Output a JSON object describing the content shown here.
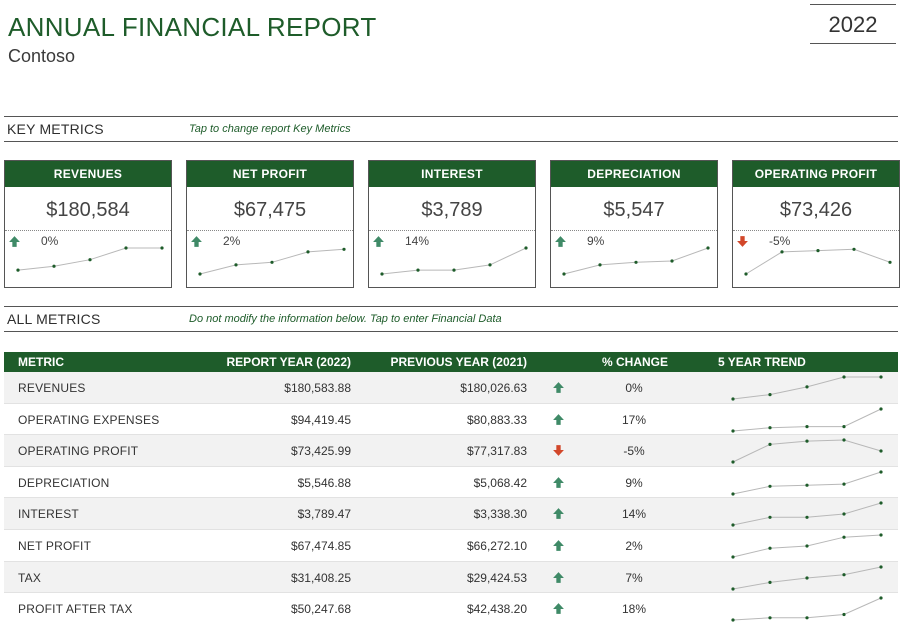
{
  "header": {
    "title": "ANNUAL FINANCIAL REPORT",
    "company": "Contoso",
    "year": "2022"
  },
  "key_metrics_section": {
    "title": "KEY METRICS",
    "note": "Tap to change report Key Metrics"
  },
  "cards": [
    {
      "label": "REVENUES",
      "value": "$180,584",
      "change": "0%",
      "direction": "up",
      "trend": [
        0.15,
        0.3,
        0.55,
        1.0,
        1.0
      ]
    },
    {
      "label": "NET PROFIT",
      "value": "$67,475",
      "change": "2%",
      "direction": "up",
      "trend": [
        0.0,
        0.35,
        0.45,
        0.85,
        0.95
      ]
    },
    {
      "label": "INTEREST",
      "value": "$3,789",
      "change": "14%",
      "direction": "up",
      "trend": [
        0.0,
        0.15,
        0.15,
        0.35,
        1.0
      ]
    },
    {
      "label": "DEPRECIATION",
      "value": "$5,547",
      "change": "9%",
      "direction": "up",
      "trend": [
        0.0,
        0.35,
        0.45,
        0.5,
        1.0
      ]
    },
    {
      "label": "OPERATING PROFIT",
      "value": "$73,426",
      "change": "-5%",
      "direction": "down",
      "trend": [
        0.0,
        0.85,
        0.9,
        0.95,
        0.45
      ]
    }
  ],
  "all_metrics_section": {
    "title": "ALL METRICS",
    "note": "Do not modify the information below. Tap to enter Financial Data"
  },
  "table": {
    "headers": {
      "metric": "METRIC",
      "report": "REPORT YEAR (2022)",
      "previous": "PREVIOUS YEAR (2021)",
      "change": "% CHANGE",
      "trend": "5 YEAR TREND"
    },
    "rows": [
      {
        "metric": "REVENUES",
        "report": "$180,583.88",
        "previous": "$180,026.63",
        "direction": "up",
        "change": "0%",
        "trend": [
          0.0,
          0.2,
          0.55,
          1.0,
          1.0
        ]
      },
      {
        "metric": "OPERATING EXPENSES",
        "report": "$94,419.45",
        "previous": "$80,883.33",
        "direction": "up",
        "change": "17%",
        "trend": [
          0.0,
          0.15,
          0.2,
          0.2,
          1.0
        ]
      },
      {
        "metric": "OPERATING PROFIT",
        "report": "$73,425.99",
        "previous": "$77,317.83",
        "direction": "down",
        "change": "-5%",
        "trend": [
          0.0,
          0.8,
          0.95,
          1.0,
          0.5
        ]
      },
      {
        "metric": "DEPRECIATION",
        "report": "$5,546.88",
        "previous": "$5,068.42",
        "direction": "up",
        "change": "9%",
        "trend": [
          0.0,
          0.35,
          0.4,
          0.45,
          1.0
        ]
      },
      {
        "metric": "INTEREST",
        "report": "$3,789.47",
        "previous": "$3,338.30",
        "direction": "up",
        "change": "14%",
        "trend": [
          0.0,
          0.35,
          0.35,
          0.5,
          1.0
        ]
      },
      {
        "metric": "NET PROFIT",
        "report": "$67,474.85",
        "previous": "$66,272.10",
        "direction": "up",
        "change": "2%",
        "trend": [
          0.0,
          0.4,
          0.5,
          0.9,
          1.0
        ]
      },
      {
        "metric": "TAX",
        "report": "$31,408.25",
        "previous": "$29,424.53",
        "direction": "up",
        "change": "7%",
        "trend": [
          0.0,
          0.3,
          0.5,
          0.65,
          1.0
        ]
      },
      {
        "metric": "PROFIT AFTER TAX",
        "report": "$50,247.68",
        "previous": "$42,438.20",
        "direction": "up",
        "change": "18%",
        "trend": [
          0.0,
          0.1,
          0.1,
          0.25,
          1.0
        ]
      }
    ]
  },
  "colors": {
    "header_green": "#1e5c2a",
    "up_arrow": "#3f8a67",
    "down_arrow": "#d2472a",
    "sparkline": "#b8b8b8",
    "marker": "#1e5c2a"
  },
  "icons": {
    "up": "arrow-up-icon",
    "down": "arrow-down-icon"
  }
}
